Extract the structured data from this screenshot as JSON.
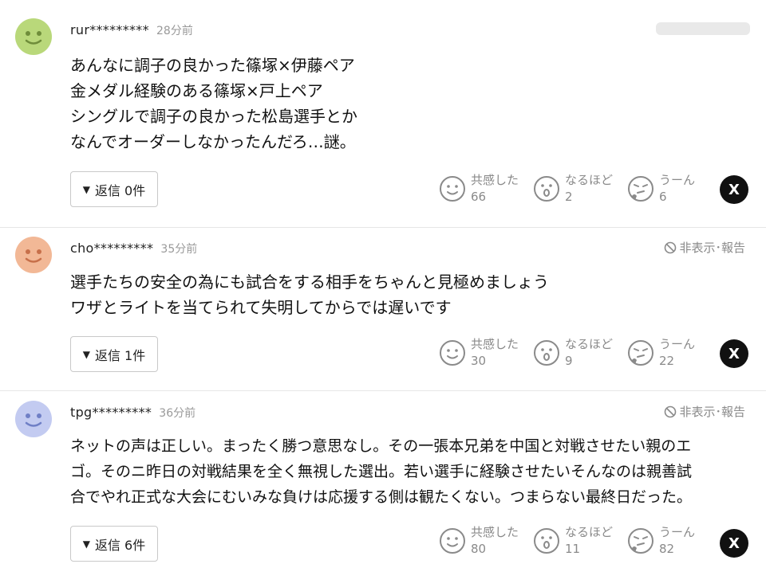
{
  "comments": [
    {
      "user": "rur*********",
      "time": "28分前",
      "report": "",
      "lines": [
        "あんなに調子の良かった篠塚×伊藤ペア",
        "金メダル経験のある篠塚×戸上ペア",
        "シングルで調子の良かった松島選手とか",
        "なんでオーダーしなかったんだろ…謎。"
      ],
      "reply_label": "返信 0件",
      "avatar_color": "#b9d87a",
      "reactions": {
        "empathy": "66",
        "naruhodo": "2",
        "uun": "6"
      }
    },
    {
      "user": "cho*********",
      "time": "35分前",
      "report": "非表示･報告",
      "lines": [
        "選手たちの安全の為にも試合をする相手をちゃんと見極めましょう",
        "ワザとライトを当てられて失明してからでは遅いです"
      ],
      "reply_label": "返信 1件",
      "avatar_color": "#f2b896",
      "reactions": {
        "empathy": "30",
        "naruhodo": "9",
        "uun": "22"
      }
    },
    {
      "user": "tpg*********",
      "time": "36分前",
      "report": "非表示･報告",
      "lines": [
        "ネットの声は正しい。まったく勝つ意思なし。その一張本兄弟を中国と対戦させたい親のエ",
        "ゴ。そのニ昨日の対戦結果を全く無視した選出。若い選手に経験させたいそんなのは親善試",
        "合でやれ正式な大会にむいみな負けは応援する側は観たくない。つまらない最終日だった。"
      ],
      "reply_label": "返信 6件",
      "avatar_color": "#c3cbf1",
      "reactions": {
        "empathy": "80",
        "naruhodo": "11",
        "uun": "82"
      }
    }
  ],
  "reaction_labels": {
    "empathy": "共感した",
    "naruhodo": "なるほど",
    "uun": "うーん"
  },
  "share_x_label": "X",
  "icons": {
    "avatar": "smiley-avatar-icon",
    "report": "no-entry-icon",
    "empathy": "smile-face-icon",
    "naruhodo": "surprised-face-icon",
    "uun": "thinking-face-icon",
    "share": "x-logo-icon"
  }
}
